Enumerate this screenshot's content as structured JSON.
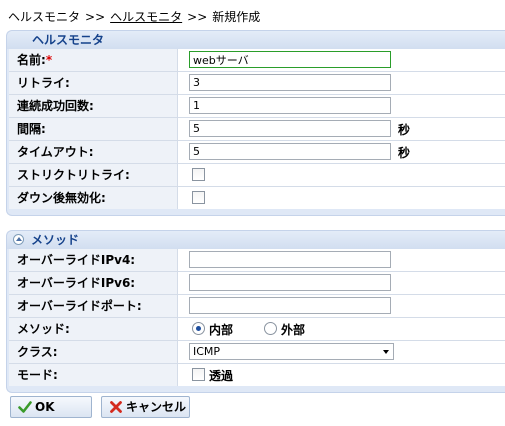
{
  "breadcrumb": {
    "root": "ヘルスモニタ",
    "separator": ">>",
    "link": "ヘルスモニタ",
    "current": "新規作成"
  },
  "health_panel": {
    "title": "ヘルスモニタ",
    "fields": {
      "name": {
        "label": "名前:",
        "required_mark": "*",
        "value": "webサーバ"
      },
      "retry": {
        "label": "リトライ:",
        "value": "3"
      },
      "consecutive_success": {
        "label": "連続成功回数:",
        "value": "1"
      },
      "interval": {
        "label": "間隔:",
        "value": "5",
        "unit": "秒"
      },
      "timeout": {
        "label": "タイムアウト:",
        "value": "5",
        "unit": "秒"
      },
      "strict_retry": {
        "label": "ストリクトリトライ:",
        "checked": false
      },
      "disable_after_down": {
        "label": "ダウン後無効化:",
        "checked": false
      }
    }
  },
  "method_panel": {
    "title": "メソッド",
    "fields": {
      "override_ipv4": {
        "label": "オーバーライドIPv4:",
        "value": ""
      },
      "override_ipv6": {
        "label": "オーバーライドIPv6:",
        "value": ""
      },
      "override_port": {
        "label": "オーバーライドポート:",
        "value": ""
      },
      "method": {
        "label": "メソッド:",
        "option_internal": "内部",
        "option_external": "外部",
        "selected": "内部"
      },
      "class": {
        "label": "クラス:",
        "selected": "ICMP"
      },
      "mode": {
        "label": "モード:",
        "checkbox_label": "透過",
        "checked": false
      }
    }
  },
  "buttons": {
    "ok": "OK",
    "cancel": "キャンセル"
  },
  "colors": {
    "panel_title": "#15428b",
    "label_bg": "#eef2f8",
    "panel_bg": "#dfe8f6",
    "focus_border": "#2a9d2a",
    "required": "#dd0000"
  }
}
